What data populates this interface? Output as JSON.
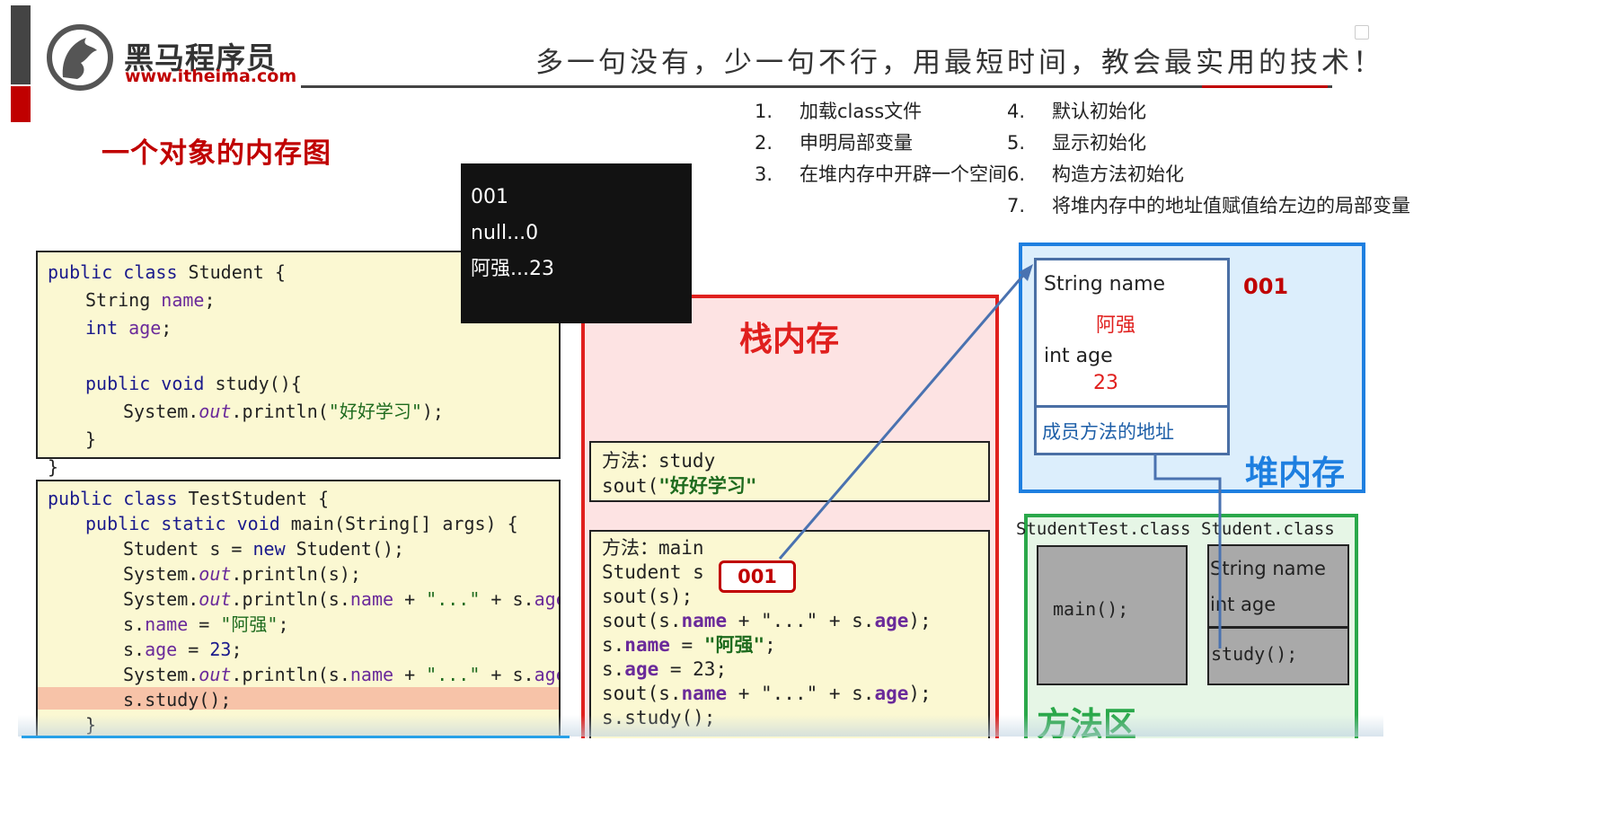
{
  "brand": {
    "name": "黑马程序员",
    "url": "www.itheima.com",
    "slogan": "多一句没有，少一句不行，用最短时间，教会最实用的技术！"
  },
  "slide_title": "一个对象的内存图",
  "steps": [
    {
      "num": "1.",
      "text": "加载class文件"
    },
    {
      "num": "2.",
      "text": "申明局部变量"
    },
    {
      "num": "3.",
      "text": "在堆内存中开辟一个空间"
    },
    {
      "num": "4.",
      "text": "默认初始化"
    },
    {
      "num": "5.",
      "text": "显示初始化"
    },
    {
      "num": "6.",
      "text": "构造方法初始化"
    },
    {
      "num": "7.",
      "text": "将堆内存中的地址值赋值给左边的局部变量"
    }
  ],
  "console": {
    "lines": [
      "001",
      "null...0",
      "阿强...23"
    ]
  },
  "code_student": {
    "l1_kw": "public class",
    "l1_rest": " Student {",
    "l2_type": "String",
    "l2_field": "name",
    "l2_end": ";",
    "l3_type": "int",
    "l3_field": "age",
    "l3_end": ";",
    "l5_kw": "public void",
    "l5_rest": " study(){",
    "l6_a": "System.",
    "l6_out": "out",
    "l6_b": ".println(",
    "l6_str": "\"好好学习\"",
    "l6_c": ");",
    "l7": "}",
    "l8": "}"
  },
  "code_test": {
    "l1_kw": "public class",
    "l1_rest": " TestStudent {",
    "l2_kw": "public static void",
    "l2_rest": " main(String[] args) {",
    "l3_a": "Student s = ",
    "l3_kw": "new",
    "l3_b": " Student();",
    "l4_a": "System.",
    "l4_out": "out",
    "l4_b": ".println(s);",
    "l5_a": "System.",
    "l5_out": "out",
    "l5_b": ".println(s.",
    "l5_f1": "name",
    "l5_c": " + ",
    "l5_str": "\"...\"",
    "l5_d": " + s.",
    "l5_f2": "age",
    "l5_e": ");",
    "l6_a": "s.",
    "l6_f": "name",
    "l6_b": " = ",
    "l6_str": "\"阿强\"",
    "l6_c": ";",
    "l7_a": "s.",
    "l7_f": "age",
    "l7_b": " = ",
    "l7_num": "23",
    "l7_c": ";",
    "l8_a": "System.",
    "l8_out": "out",
    "l8_b": ".println(s.",
    "l8_f1": "name",
    "l8_c": " + ",
    "l8_str": "\"...\"",
    "l8_d": " + s.",
    "l8_f2": "age",
    "l8_e": ");",
    "l9": "s.study();",
    "l10": "}"
  },
  "stack": {
    "title": "栈内存",
    "study_frame": {
      "l1": "方法：study",
      "l2_a": "sout(",
      "l2_str": "\"好好学习\""
    },
    "main_frame": {
      "l1": "方法：main",
      "l2": "Student s",
      "s_value": "001",
      "l3": "sout(s);",
      "l4_a": "sout(s.",
      "l4_f1": "name",
      "l4_b": " + \"...\" + s.",
      "l4_f2": "age",
      "l4_c": ");",
      "l5_a": "s.",
      "l5_f": "name",
      "l5_b": " = ",
      "l5_str": "\"阿强\"",
      "l5_c": ";",
      "l6_a": "s.",
      "l6_f": "age",
      "l6_b": " = 23;",
      "l7_a": "sout(s.",
      "l7_f1": "name",
      "l7_b": " + \"...\" + s.",
      "l7_f2": "age",
      "l7_c": ");",
      "l8": "s.study();"
    }
  },
  "heap": {
    "title": "堆内存",
    "address": "001",
    "field1": "String name",
    "value1": "阿强",
    "field2": "int age",
    "value2": "23",
    "method_addr": "成员方法的地址"
  },
  "method_area": {
    "title": "方法区",
    "class1": "StudentTest.class",
    "class1_body": "main();",
    "class2": "Student.class",
    "class2_f1": "String name",
    "class2_f2": "int age",
    "class2_m": "study();"
  },
  "colors": {
    "accent_red": "#c00000",
    "stack_border": "#e0201e",
    "heap_border": "#1e7fe0",
    "method_area_border": "#2aa84a",
    "code_bg": "#fbf8d2",
    "highlight_row": "#f7c3a8"
  }
}
